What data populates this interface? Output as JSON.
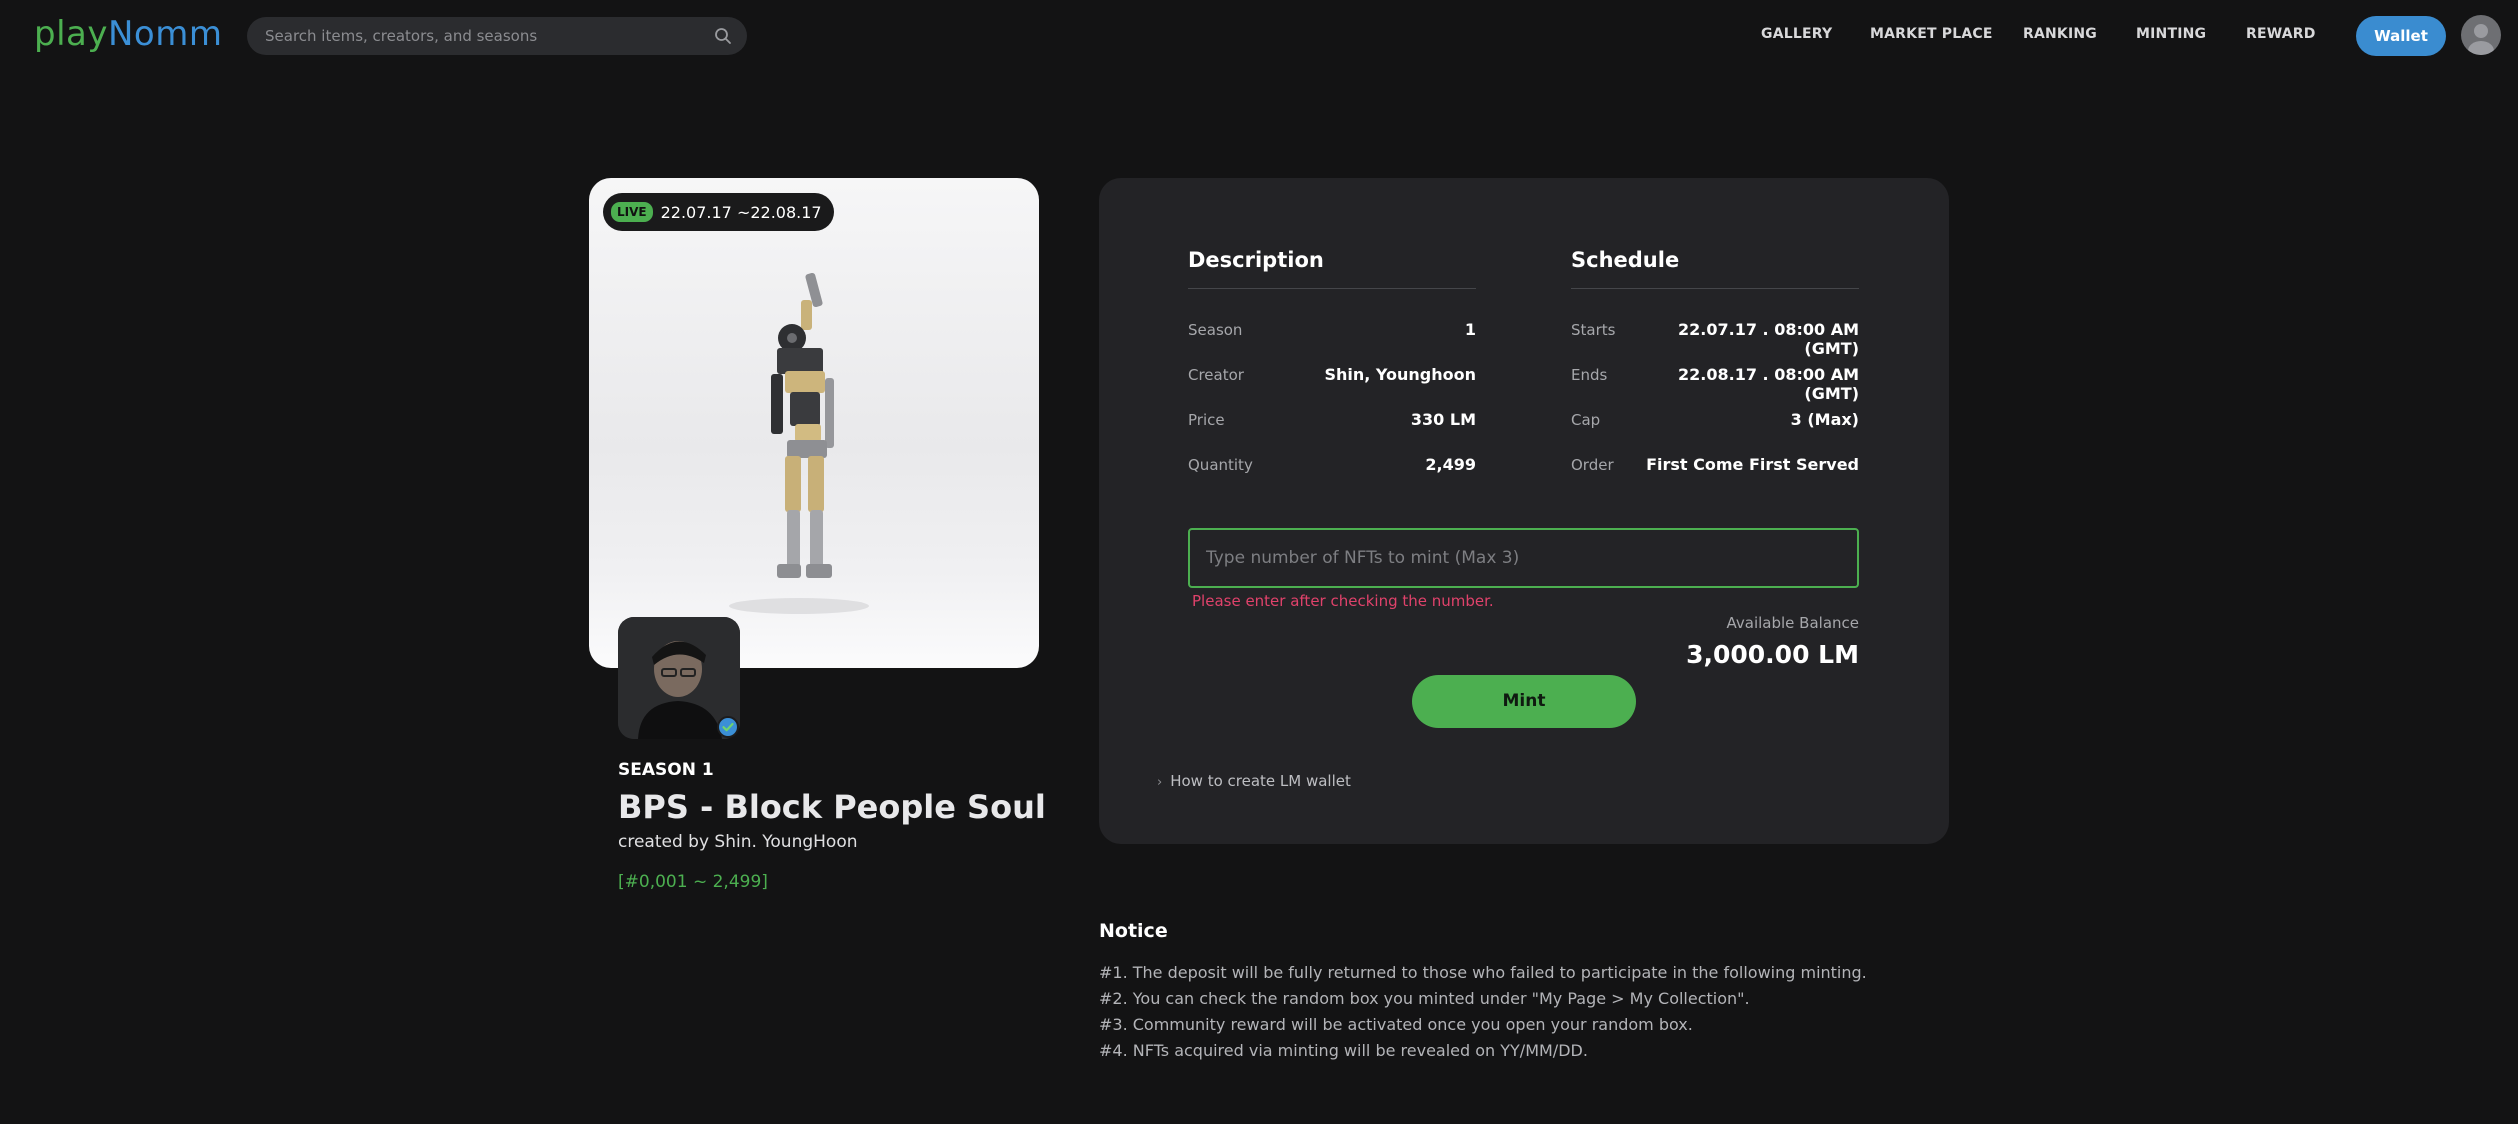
{
  "header": {
    "logo_part1": "play",
    "logo_part2": "Nomm",
    "search_placeholder": "Search items, creators, and seasons",
    "nav": [
      "GALLERY",
      "MARKET PLACE",
      "RANKING",
      "MINTING",
      "REWARD"
    ],
    "wallet_label": "Wallet"
  },
  "colors": {
    "accent_green": "#4caf50",
    "accent_blue": "#3a8cd0",
    "error": "#e0426b"
  },
  "item": {
    "live_badge": "LIVE",
    "live_dates": "22.07.17 ~22.08.17",
    "season_label": "SEASON 1",
    "title": "BPS - Block People Soul",
    "created_by": "created by Shin. YoungHoon",
    "range": "[#0,001 ~ 2,499]"
  },
  "description": {
    "title": "Description",
    "rows": [
      {
        "label": "Season",
        "value": "1"
      },
      {
        "label": "Creator",
        "value": "Shin, Younghoon"
      },
      {
        "label": "Price",
        "value": "330 LM"
      },
      {
        "label": "Quantity",
        "value": "2,499"
      }
    ]
  },
  "schedule": {
    "title": "Schedule",
    "rows": [
      {
        "label": "Starts",
        "value": "22.07.17 . 08:00 AM (GMT)"
      },
      {
        "label": "Ends",
        "value": "22.08.17 . 08:00 AM (GMT)"
      },
      {
        "label": "Cap",
        "value": "3 (Max)"
      },
      {
        "label": "Order",
        "value": "First Come First Served"
      }
    ]
  },
  "mint": {
    "input_placeholder": "Type number of NFTs to mint (Max 3)",
    "error": "Please enter after checking the number.",
    "balance_label": "Available Balance",
    "balance_value": "3,000.00 LM",
    "button_label": "Mint",
    "howto_link": "How to create LM wallet"
  },
  "notice": {
    "title": "Notice",
    "lines": [
      "#1. The deposit will be fully returned to those who failed to participate in the following minting.",
      "#2. You can check the random box you minted under \"My Page > My Collection\".",
      "#3. Community reward will be activated once you open your random box.",
      "#4. NFTs acquired via minting will be revealed on YY/MM/DD."
    ]
  },
  "icons": [
    "search-icon",
    "verified-badge-icon",
    "chevron-right-icon"
  ]
}
